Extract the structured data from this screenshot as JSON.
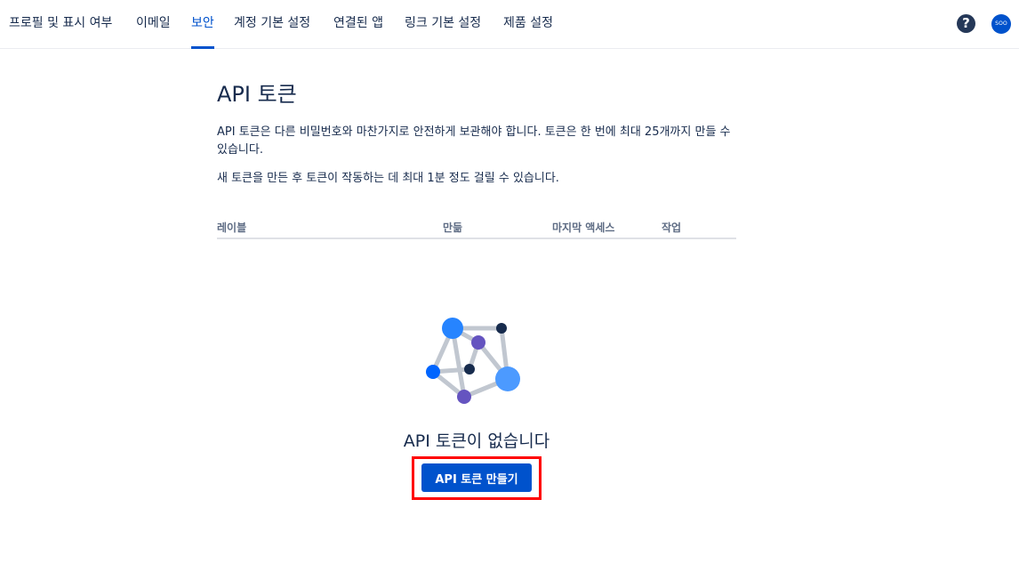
{
  "nav": {
    "tabs": [
      {
        "label": "프로필 및 표시 여부",
        "active": false
      },
      {
        "label": "이메일",
        "active": false
      },
      {
        "label": "보안",
        "active": true
      },
      {
        "label": "계정 기본 설정",
        "active": false
      },
      {
        "label": "연결된 앱",
        "active": false
      },
      {
        "label": "링크 기본 설정",
        "active": false
      },
      {
        "label": "제품 설정",
        "active": false
      }
    ],
    "help_icon": "?",
    "avatar_initials": "SOO"
  },
  "page": {
    "title": "API 토큰",
    "description_1": "API 토큰은 다른 비밀번호와 마찬가지로 안전하게 보관해야 합니다. 토큰은 한 번에 최대 25개까지 만들 수 있습니다.",
    "description_2": "새 토큰을 만든 후 토큰이 작동하는 데 최대 1분 정도 걸릴 수 있습니다."
  },
  "table": {
    "columns": [
      "레이블",
      "만듦",
      "마지막 액세스",
      "작업"
    ]
  },
  "empty_state": {
    "title": "API 토큰이 없습니다",
    "button_label": "API 토큰 만들기"
  },
  "colors": {
    "primary": "#0052CC",
    "text": "#172B4D",
    "highlight": "#FF0000"
  }
}
